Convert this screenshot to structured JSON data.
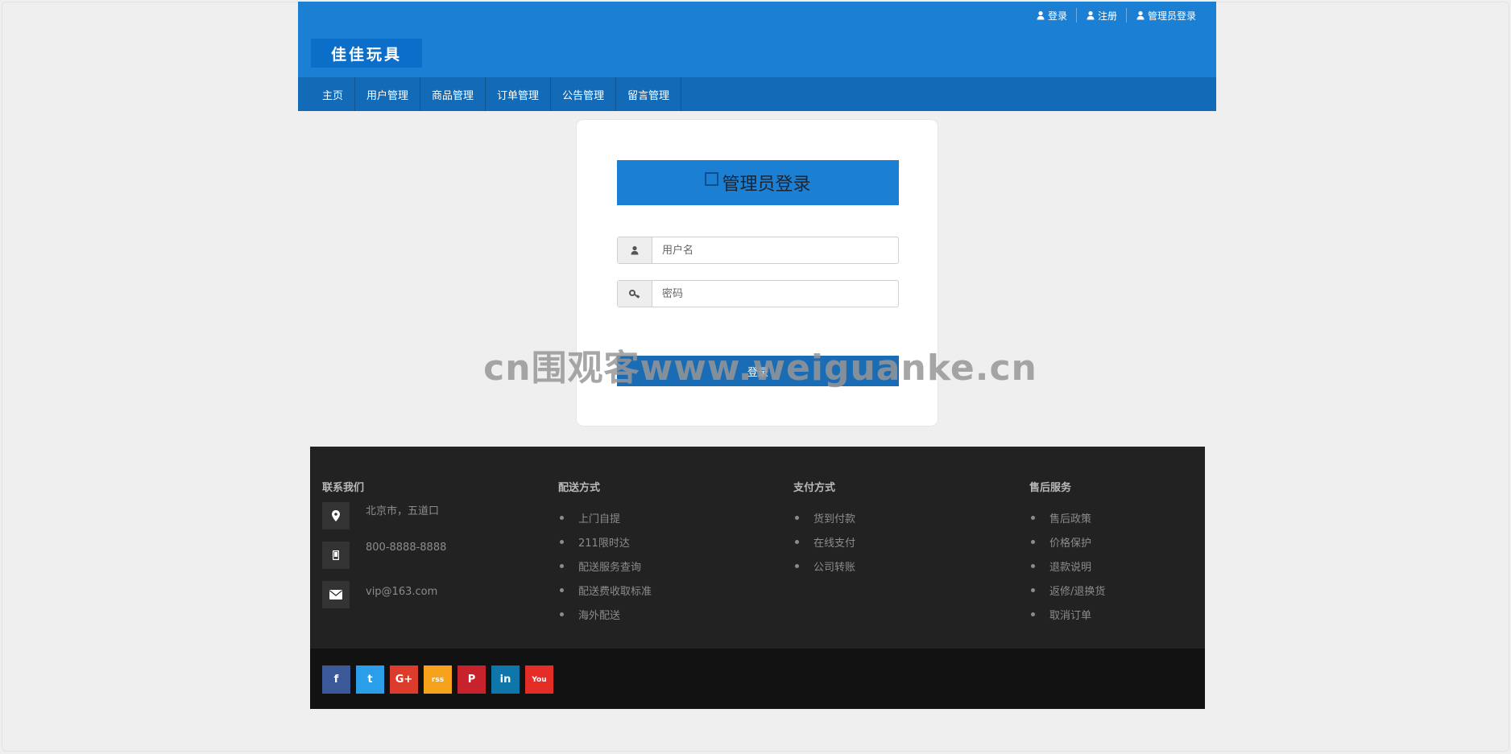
{
  "topbar": {
    "login": "登录",
    "register": "注册",
    "admin_login": "管理员登录"
  },
  "brand": {
    "logo_text": "佳佳玩具",
    "color": "#1b80d4"
  },
  "nav": {
    "items": [
      "主页",
      "用户管理",
      "商品管理",
      "订单管理",
      "公告管理",
      "留言管理"
    ]
  },
  "login": {
    "title": "管理员登录",
    "username_placeholder": "用户名",
    "password_placeholder": "密码",
    "button": "登录",
    "username_icon": "user-icon",
    "password_icon": "key-icon"
  },
  "watermark": "cn围观客www.weiguanke.cn",
  "footer": {
    "contact": {
      "heading": "联系我们",
      "address": "北京市，五道口",
      "phone": "800-8888-8888",
      "email": "vip@163.com"
    },
    "delivery": {
      "heading": "配送方式",
      "items": [
        "上门自提",
        "211限时达",
        "配送服务查询",
        "配送费收取标准",
        "海外配送"
      ]
    },
    "payment": {
      "heading": "支付方式",
      "items": [
        "货到付款",
        "在线支付",
        "公司转账"
      ]
    },
    "service": {
      "heading": "售后服务",
      "items": [
        "售后政策",
        "价格保护",
        "退款说明",
        "返修/退换货",
        "取消订单"
      ]
    }
  },
  "social": [
    {
      "name": "facebook-icon",
      "glyph": "f",
      "color": "#3b5998"
    },
    {
      "name": "twitter-icon",
      "glyph": "t",
      "color": "#2a9ee8"
    },
    {
      "name": "google-plus-icon",
      "glyph": "G+",
      "color": "#dd3b2c"
    },
    {
      "name": "rss-icon",
      "glyph": "rss",
      "color": "#f7a21b"
    },
    {
      "name": "pinterest-icon",
      "glyph": "P",
      "color": "#c8232c"
    },
    {
      "name": "linkedin-icon",
      "glyph": "in",
      "color": "#0e76a8"
    },
    {
      "name": "youtube-icon",
      "glyph": "You",
      "color": "#e52d27"
    }
  ]
}
